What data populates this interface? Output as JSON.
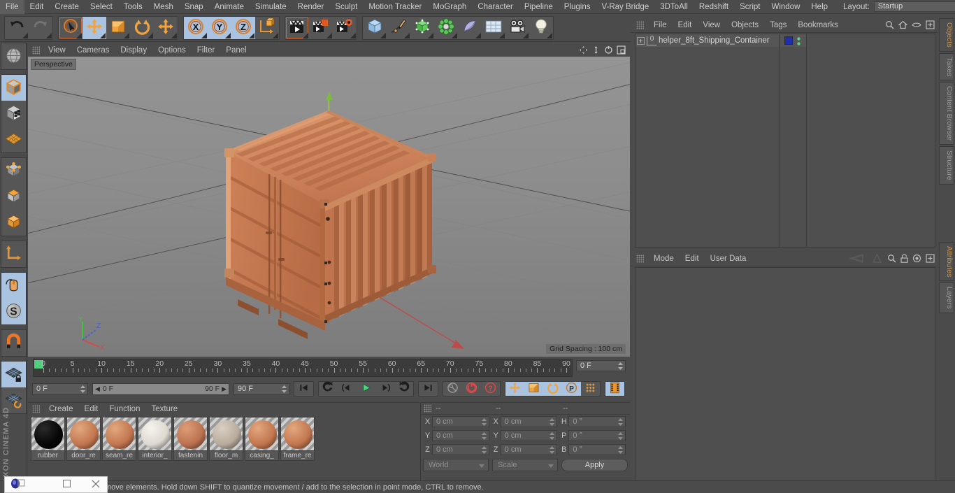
{
  "app": {
    "brand": "MAXON CINEMA 4D"
  },
  "menubar": {
    "items": [
      "File",
      "Edit",
      "Create",
      "Select",
      "Tools",
      "Mesh",
      "Snap",
      "Animate",
      "Simulate",
      "Render",
      "Sculpt",
      "Motion Tracker",
      "MoGraph",
      "Character",
      "Pipeline",
      "Plugins",
      "V-Ray Bridge",
      "3DToAll",
      "Redshift",
      "Script",
      "Window",
      "Help"
    ],
    "layout_label": "Layout:",
    "layout_value": "Startup",
    "search_icon": "search-icon"
  },
  "toolbar": {
    "groups": [
      {
        "name": "undo-redo",
        "buttons": [
          {
            "name": "undo-button",
            "icon": "undo-arrow-icon",
            "selected": false
          },
          {
            "name": "redo-button",
            "icon": "redo-arrow-icon",
            "selected": false
          }
        ]
      },
      {
        "name": "transform-tools",
        "buttons": [
          {
            "name": "live-selection-tool",
            "icon": "cursor-circle-icon",
            "selected": false,
            "active": true
          },
          {
            "name": "move-tool",
            "icon": "move-arrows-icon",
            "selected": true
          },
          {
            "name": "scale-tool",
            "icon": "scale-box-icon",
            "selected": false
          },
          {
            "name": "rotate-tool",
            "icon": "rotate-arrows-icon",
            "selected": false
          },
          {
            "name": "transform-tool",
            "icon": "move-arrows-icon",
            "selected": false
          }
        ]
      },
      {
        "name": "axis-locks",
        "buttons": [
          {
            "name": "lock-x-axis",
            "icon": "x-axis-icon",
            "selected": true
          },
          {
            "name": "lock-y-axis",
            "icon": "y-axis-icon",
            "selected": true
          },
          {
            "name": "lock-z-axis",
            "icon": "z-axis-icon",
            "selected": true
          },
          {
            "name": "world-object-coordinates",
            "icon": "axis-cube-icon",
            "selected": false
          }
        ]
      },
      {
        "name": "render-tools",
        "buttons": [
          {
            "name": "render-view-button",
            "icon": "clapper-icon",
            "selected": false,
            "active": true
          },
          {
            "name": "render-to-picture-viewer-button",
            "icon": "clapper-region-icon",
            "selected": false
          },
          {
            "name": "render-settings-button",
            "icon": "clapper-gear-icon",
            "selected": false
          }
        ]
      },
      {
        "name": "create-objects",
        "buttons": [
          {
            "name": "add-primitive-cube-button",
            "icon": "blue-cube-icon",
            "selected": false
          },
          {
            "name": "add-spline-button",
            "icon": "pen-spline-icon",
            "selected": false
          },
          {
            "name": "add-generator-button",
            "icon": "green-cube-icon",
            "selected": false
          },
          {
            "name": "add-mograph-button",
            "icon": "green-cluster-icon",
            "selected": false
          },
          {
            "name": "add-deformer-button",
            "icon": "bend-shape-icon",
            "selected": false
          },
          {
            "name": "add-scene-environment-button",
            "icon": "floor-grid-icon",
            "selected": false
          },
          {
            "name": "add-camera-button",
            "icon": "camera-icon",
            "selected": false
          },
          {
            "name": "add-light-button",
            "icon": "light-bulb-icon",
            "selected": false
          }
        ]
      }
    ]
  },
  "left_palette": {
    "groups": [
      {
        "name": "tweak-mode",
        "buttons": [
          {
            "name": "tweak-mode-button",
            "icon": "globe-mesh-icon",
            "selected": false
          }
        ]
      },
      {
        "name": "editor-modes",
        "buttons": [
          {
            "name": "model-mode-button",
            "icon": "model-cube-icon",
            "selected": true
          },
          {
            "name": "texture-mode-button",
            "icon": "texture-cube-icon",
            "selected": false
          },
          {
            "name": "workplane-mode-button",
            "icon": "workplane-grid-icon",
            "selected": false
          }
        ]
      },
      {
        "name": "component-modes",
        "buttons": [
          {
            "name": "points-mode-button",
            "icon": "points-cube-icon",
            "selected": false
          },
          {
            "name": "edges-mode-button",
            "icon": "edges-cube-icon",
            "selected": false
          },
          {
            "name": "polygons-mode-button",
            "icon": "polygons-cube-icon",
            "selected": false
          }
        ]
      },
      {
        "name": "axis-tools",
        "buttons": [
          {
            "name": "enable-axis-modification-button",
            "icon": "axis-corner-icon",
            "selected": false
          }
        ]
      },
      {
        "name": "interaction-tools",
        "buttons": [
          {
            "name": "viewport-solo-button",
            "icon": "mouse-icon",
            "selected": true
          },
          {
            "name": "soft-selection-button",
            "icon": "s-sphere-icon",
            "selected": true
          }
        ]
      },
      {
        "name": "snap-group",
        "buttons": [
          {
            "name": "enable-snap-button",
            "icon": "magnet-icon",
            "selected": false
          }
        ]
      },
      {
        "name": "workplane-group",
        "buttons": [
          {
            "name": "lock-workplane-button",
            "icon": "grid-lock-icon",
            "selected": true
          },
          {
            "name": "planar-workplane-button",
            "icon": "grid-rotate-icon",
            "selected": false
          }
        ]
      }
    ]
  },
  "viewport": {
    "menu_items": [
      "View",
      "Cameras",
      "Display",
      "Options",
      "Filter",
      "Panel"
    ],
    "corner_icons": [
      "pan-icon",
      "dolly-icon",
      "rotate-icon",
      "maximize-icon"
    ],
    "label": "Perspective",
    "grid_spacing": "Grid Spacing : 100 cm",
    "axis_gizmo": {
      "x": "X",
      "y": "Y",
      "z": "Z",
      "x_color": "#d94f4f",
      "y_color": "#4fd94f",
      "z_color": "#4f6fd9"
    },
    "scene_object": "helper_8ft_Shipping_Container",
    "container_color": "#d4835c"
  },
  "timeline": {
    "ticks": [
      "0",
      "5",
      "10",
      "15",
      "20",
      "25",
      "30",
      "35",
      "40",
      "45",
      "50",
      "55",
      "60",
      "65",
      "70",
      "75",
      "80",
      "85",
      "90"
    ],
    "current_frame_field": "0 F",
    "start_frame": "0 F",
    "preview_min": "0 F",
    "preview_max": "90 F",
    "end_frame": "90 F"
  },
  "transport": {
    "buttons": [
      {
        "name": "go-to-start-button",
        "icon": "skip-start-icon",
        "selected": false
      },
      {
        "name": "go-to-previous-keyframe-button",
        "icon": "prev-key-icon",
        "selected": false
      },
      {
        "name": "step-back-button",
        "icon": "step-back-icon",
        "selected": false
      },
      {
        "name": "play-button",
        "icon": "play-icon",
        "selected": false
      },
      {
        "name": "step-forward-button",
        "icon": "step-forward-icon",
        "selected": false
      },
      {
        "name": "go-to-next-keyframe-button",
        "icon": "next-key-icon",
        "selected": false
      },
      {
        "name": "go-to-end-button",
        "icon": "skip-end-icon",
        "selected": false
      }
    ],
    "record_group": [
      {
        "name": "record-active-objects-button",
        "icon": "key-icon",
        "selected": false
      },
      {
        "name": "autokeying-button",
        "icon": "red-record-icon",
        "selected": false
      },
      {
        "name": "keyframe-selection-button",
        "icon": "red-question-icon",
        "selected": false
      }
    ],
    "param_group": [
      {
        "name": "position-keying-button",
        "icon": "move-arrows-icon",
        "selected": true
      },
      {
        "name": "scale-keying-button",
        "icon": "scale-box-icon",
        "selected": true
      },
      {
        "name": "rotation-keying-button",
        "icon": "rotate-arrows-icon",
        "selected": true
      },
      {
        "name": "parameter-keying-button",
        "icon": "p-circle-icon",
        "selected": true
      },
      {
        "name": "point-level-animation-button",
        "icon": "dots-grid-icon",
        "selected": false
      }
    ],
    "timeline_toggle": {
      "name": "timeline-mode-button",
      "icon": "filmstrip-icon",
      "selected": true
    }
  },
  "material_manager": {
    "menu_items": [
      "Create",
      "Edit",
      "Function",
      "Texture"
    ],
    "materials": [
      {
        "name": "rubber",
        "color": "#060606",
        "highlight": "#2a2a2a"
      },
      {
        "name": "door_re",
        "color": "#c2764f",
        "highlight": "#e2a87e"
      },
      {
        "name": "seam_re",
        "color": "#c2764f",
        "highlight": "#e2a87e"
      },
      {
        "name": "interior_",
        "color": "#ded8cf",
        "highlight": "#f6f4ef"
      },
      {
        "name": "fastenin",
        "color": "#bb7150",
        "highlight": "#dd9d77"
      },
      {
        "name": "floor_m",
        "color": "#b8ab9c",
        "highlight": "#d9cfc2"
      },
      {
        "name": "casing_",
        "color": "#c2764f",
        "highlight": "#e2a87e"
      },
      {
        "name": "frame_re",
        "color": "#c2764f",
        "highlight": "#e2a87e"
      }
    ]
  },
  "coordinate_manager": {
    "headers": [
      "--",
      "--",
      "--"
    ],
    "rows": [
      {
        "pos_label": "X",
        "pos_value": "0 cm",
        "size_label": "X",
        "size_value": "0 cm",
        "rot_label": "H",
        "rot_value": "0 °"
      },
      {
        "pos_label": "Y",
        "pos_value": "0 cm",
        "size_label": "Y",
        "size_value": "0 cm",
        "rot_label": "P",
        "rot_value": "0 °"
      },
      {
        "pos_label": "Z",
        "pos_value": "0 cm",
        "size_label": "Z",
        "size_value": "0 cm",
        "rot_label": "B",
        "rot_value": "0 °"
      }
    ],
    "system_dropdown": "World",
    "mode_dropdown": "Scale",
    "apply_button": "Apply"
  },
  "object_manager": {
    "menu_items": [
      "File",
      "Edit",
      "View",
      "Objects",
      "Tags",
      "Bookmarks"
    ],
    "icons": [
      "search-icon",
      "home-icon",
      "ellipse-icon",
      "add-panel-icon"
    ],
    "object": {
      "name": "helper_8ft_Shipping_Container",
      "layer_badge": "0"
    }
  },
  "attribute_manager": {
    "menu_items": [
      "Mode",
      "Edit",
      "User Data"
    ],
    "icons": [
      "back-history-icon",
      "forward-history-icon",
      "search-icon",
      "lock-icon",
      "target-icon",
      "add-panel-icon"
    ]
  },
  "right_tabs": {
    "upper": [
      {
        "label": "Objects",
        "active": true
      },
      {
        "label": "Takes",
        "active": false
      },
      {
        "label": "Content Browser",
        "active": false
      },
      {
        "label": "Structure",
        "active": false
      }
    ],
    "lower": [
      {
        "label": "Attributes",
        "active": true
      },
      {
        "label": "Layers",
        "active": false
      }
    ]
  },
  "statusbar": {
    "message": "move elements. Hold down SHIFT to quantize movement / add to the selection in point mode, CTRL to remove."
  },
  "mini_window": {
    "app_icon": "c4d-app-icon",
    "restore_icon": "restore-window-icon",
    "maximize_icon": "maximize-window-icon",
    "close_icon": "close-window-icon"
  },
  "colors": {
    "panel_bg": "#4b4b4b",
    "accent_orange": "#d9902e",
    "selection_blue": "#aac3e0",
    "viewport_gray": "#8a8a8a"
  }
}
